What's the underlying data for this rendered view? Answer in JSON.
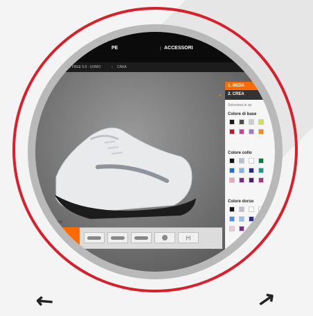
{
  "nav": {
    "item1": "PE",
    "separator": "|",
    "item2": "ACCESSORI"
  },
  "breadcrumb": {
    "part1": "E FREE 5.0 - UOMO",
    "sep": "›",
    "part2": "CREA"
  },
  "steps": {
    "step1": "1. INIZIA",
    "step2": "2. CREA",
    "hint": "Seleziona le op"
  },
  "sections": [
    {
      "title": "Colore di base",
      "rows": [
        [
          "#1a1a1a",
          "#4d4d4d",
          "#c7cfd8",
          "#cde64a"
        ],
        [
          "#c8102e",
          "#c8429a",
          "#9a7bd0",
          "#ff8a00"
        ]
      ]
    },
    {
      "title": "Colore collo",
      "rows": [
        [
          "#111111",
          "#b9c0c8",
          "#ffffff",
          "#0a7a3d"
        ],
        [
          "#1d6fd1",
          "#7db7e8",
          "#2a2a8a",
          "#1b9b8e"
        ],
        [
          "#e8a6c6",
          "#7b2a8f",
          "#4a1f6b",
          "#a33a7a"
        ]
      ]
    },
    {
      "title": "Colore dorso",
      "rows": [
        [
          "#111111",
          "#b9c0c8",
          "#ffffff",
          "#ffffff"
        ],
        [
          "#4a90d9",
          "#8fc3ea",
          "#2a2a8a",
          "#6a4ab0"
        ],
        [
          "#f0c8dc",
          "#7b2a8f",
          "#ffffff",
          "#ffffff"
        ]
      ]
    }
  ],
  "toolbar": {
    "label": "NS",
    "thumb1": "",
    "thumb6": "[+]"
  },
  "colors": {
    "accent": "#ff6a00",
    "ring": "#d81f2a"
  }
}
